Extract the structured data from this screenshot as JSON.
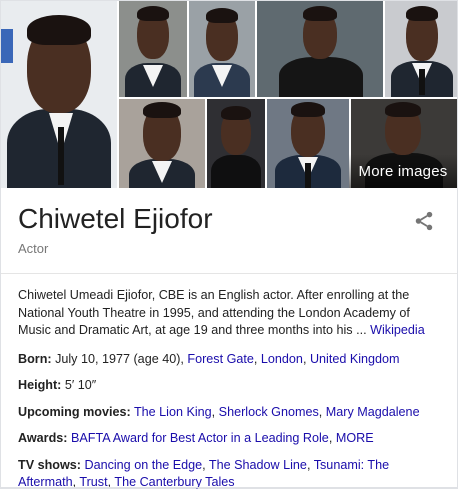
{
  "gallery": {
    "more_images_label": "More images",
    "tiles": [
      {
        "id": "photo-1",
        "bg": "#e9ecef",
        "accent": "#3a67b8"
      },
      {
        "id": "photo-2",
        "bg": "#8c8f8c"
      },
      {
        "id": "photo-3",
        "bg": "#9aa1a6"
      },
      {
        "id": "photo-4",
        "bg": "#5f6a70"
      },
      {
        "id": "photo-5",
        "bg": "#c9cbcf"
      },
      {
        "id": "photo-6",
        "bg": "#a9a29b"
      },
      {
        "id": "photo-7",
        "bg": "#2f2f33"
      },
      {
        "id": "photo-8",
        "bg": "#6f7884"
      },
      {
        "id": "photo-9",
        "bg": "#3c3a38"
      }
    ]
  },
  "header": {
    "title": "Chiwetel Ejiofor",
    "subtitle": "Actor",
    "share_icon": "share-icon"
  },
  "description": {
    "text": "Chiwetel Umeadi Ejiofor, CBE is an English actor. After enrolling at the National Youth Theatre in 1995, and attending the London Academy of Music and Dramatic Art, at age 19 and three months into his ... ",
    "source_link": "Wikipedia"
  },
  "facts": {
    "born": {
      "label": "Born:",
      "value": " July 10, 1977 (age 40), ",
      "links": [
        "Forest Gate",
        "London",
        "United Kingdom"
      ]
    },
    "height": {
      "label": "Height:",
      "value": " 5′ 10″"
    },
    "upcoming_movies": {
      "label": "Upcoming movies:",
      "links": [
        "The Lion King",
        "Sherlock Gnomes",
        "Mary Magdalene"
      ]
    },
    "awards": {
      "label": "Awards:",
      "links": [
        "BAFTA Award for Best Actor in a Leading Role",
        "MORE"
      ]
    },
    "tv_shows": {
      "label": "TV shows:",
      "links": [
        "Dancing on the Edge",
        "The Shadow Line",
        "Tsunami: The Aftermath",
        "Trust",
        "The Canterbury Tales"
      ]
    }
  },
  "colors": {
    "link": "#1a0dab",
    "text": "#222222",
    "muted": "#777777",
    "border": "#dfe1e5"
  }
}
